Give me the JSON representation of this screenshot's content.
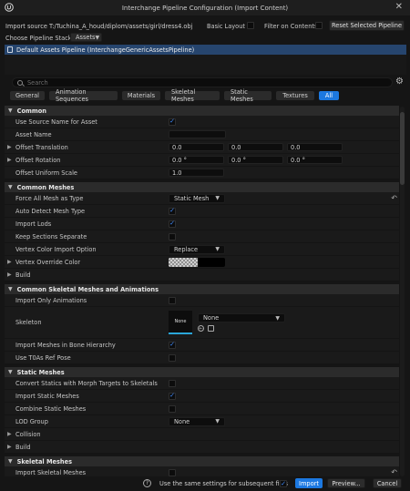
{
  "window": {
    "title": "Interchange Pipeline Configuration (Import Content)",
    "close_glyph": "✕"
  },
  "import_source": {
    "label": "Import source T:/Tuchina_A_houd/diplom/assets/girl/dress4.obj",
    "basic_layout_label": "Basic Layout",
    "filter_on_contents_label": "Filter on Contents",
    "reset_button_label": "Reset Selected Pipeline"
  },
  "pipeline_stack": {
    "label": "Choose Pipeline Stack:",
    "selected": "Assets"
  },
  "pipelines": [
    {
      "label": "Default Assets Pipeline (InterchangeGenericAssetsPipeline)"
    }
  ],
  "search": {
    "placeholder": "Search"
  },
  "tabs": [
    {
      "label": "General",
      "active": false
    },
    {
      "label": "Animation Sequences",
      "active": false
    },
    {
      "label": "Materials",
      "active": false
    },
    {
      "label": "Skeletal Meshes",
      "active": false
    },
    {
      "label": "Static Meshes",
      "active": false
    },
    {
      "label": "Textures",
      "active": false
    },
    {
      "label": "All",
      "active": true
    }
  ],
  "sections": {
    "common": {
      "title": "Common",
      "use_source_name": "Use Source Name for Asset",
      "asset_name": "Asset Name",
      "offset_translation": {
        "label": "Offset Translation",
        "x": "0.0",
        "y": "0.0",
        "z": "0.0"
      },
      "offset_rotation": {
        "label": "Offset Rotation",
        "x": "0.0 °",
        "y": "0.0 °",
        "z": "0.0 °"
      },
      "offset_uniform_scale": {
        "label": "Offset Uniform Scale",
        "value": "1.0"
      }
    },
    "common_meshes": {
      "title": "Common Meshes",
      "force_all_mesh_as_type": {
        "label": "Force All Mesh as Type",
        "value": "Static Mesh"
      },
      "auto_detect_mesh_type": "Auto Detect Mesh Type",
      "import_lods": "Import Lods",
      "keep_sections_separate": "Keep Sections Separate",
      "vertex_color_import_option": {
        "label": "Vertex Color Import Option",
        "value": "Replace"
      },
      "vertex_override_color": "Vertex Override Color",
      "build": "Build"
    },
    "common_skeletal": {
      "title": "Common Skeletal Meshes and Animations",
      "import_only_animations": "Import Only Animations",
      "skeleton": {
        "label": "Skeleton",
        "thumb_text": "None",
        "value": "None"
      },
      "import_meshes_in_bone_hierarchy": "Import Meshes in Bone Hierarchy",
      "use_t0_as_ref_pose": "Use T0As Ref Pose"
    },
    "static_meshes": {
      "title": "Static Meshes",
      "convert_statics": "Convert Statics with Morph Targets to Skeletals",
      "import_static_meshes": "Import Static Meshes",
      "combine_static_meshes": "Combine Static Meshes",
      "lod_group": {
        "label": "LOD Group",
        "value": "None"
      },
      "collision": "Collision",
      "build": "Build"
    },
    "skeletal_meshes": {
      "title": "Skeletal Meshes",
      "import_skeletal_meshes": "Import Skeletal Meshes"
    }
  },
  "footer": {
    "help_glyph": "?",
    "same_settings_label": "Use the same settings for subsequent files",
    "import_label": "Import",
    "preview_label": "Preview...",
    "cancel_label": "Cancel"
  },
  "colors": {
    "accent": "#1c78e0",
    "selected_row": "#26456e",
    "background": "#151515"
  }
}
